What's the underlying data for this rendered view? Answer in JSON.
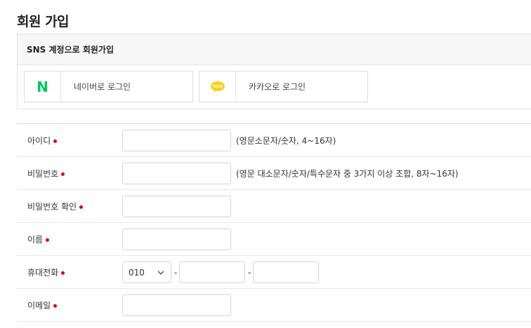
{
  "page": {
    "title": "회원 가입"
  },
  "sns": {
    "heading": "SNS 계정으로 회원가입",
    "naver": {
      "label": "네이버로 로그인",
      "icon": "naver-n-icon",
      "letter": "N",
      "color": "#03c75a"
    },
    "kakao": {
      "label": "카카오로 로그인",
      "icon": "kakao-talk-icon",
      "badge": "TALK",
      "color": "#f7d21f"
    }
  },
  "form": {
    "required_color": "#e00000",
    "fields": {
      "userid": {
        "label": "아이디",
        "value": "",
        "hint": "(영문소문자/숫자, 4~16자)"
      },
      "password": {
        "label": "비밀번호",
        "value": "",
        "hint": "(영문 대소문자/숫자/특수문자 중 3가지 이상 조합, 8자~16자)"
      },
      "password_confirm": {
        "label": "비밀번호 확인",
        "value": ""
      },
      "name": {
        "label": "이름",
        "value": ""
      },
      "phone": {
        "label": "휴대전화",
        "prefix": "010",
        "dash": "-",
        "middle": "",
        "last": ""
      },
      "email": {
        "label": "이메일",
        "value": ""
      }
    }
  }
}
